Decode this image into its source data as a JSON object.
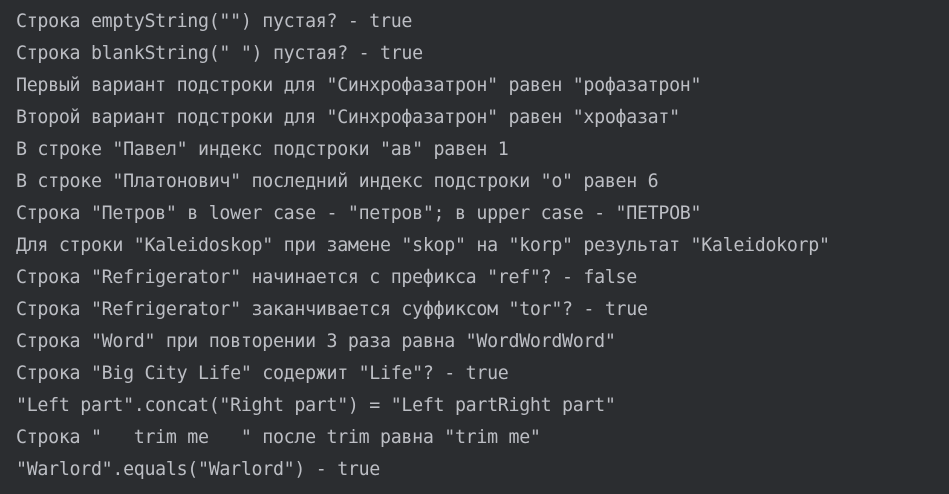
{
  "console": {
    "lines": [
      "",
      "Строка emptyString(\"\") пустая? - true",
      "Строка blankString(\" \") пустая? - true",
      "Первый вариант подстроки для \"Синхрофазатрон\" равен \"рофазатрон\"",
      "Второй вариант подстроки для \"Синхрофазатрон\" равен \"хрофазат\"",
      "В строке \"Павел\" индекс подстроки \"ав\" равен 1",
      "В строке \"Платонович\" последний индекс подстроки \"о\" равен 6",
      "Строка \"Петров\" в lower case - \"петров\"; в upper case - \"ПЕТРОВ\"",
      "Для строки \"Kaleidoskop\" при замене \"skop\" на \"korp\" результат \"Kaleidokorp\"",
      "Строка \"Refrigerator\" начинается с префикса \"ref\"? - false",
      "Строка \"Refrigerator\" заканчивается суффиксом \"tor\"? - true",
      "Строка \"Word\" при повторении 3 раза равна \"WordWordWord\"",
      "Строка \"Big City Life\" содержит \"Life\"? - true",
      "\"Left part\".concat(\"Right part\") = \"Left partRight part\"",
      "Строка \"   trim me   \" после trim равна \"trim me\"",
      "\"Warlord\".equals(\"Warlord\") - true",
      ""
    ]
  }
}
